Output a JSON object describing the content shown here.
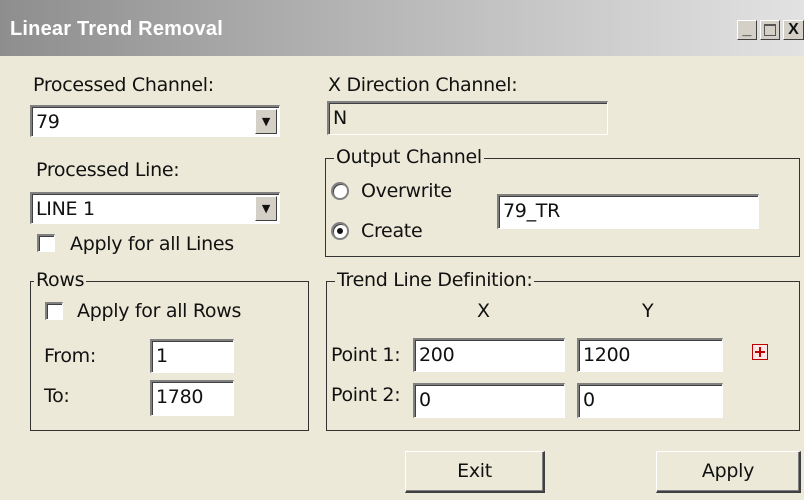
{
  "window": {
    "title": "Linear Trend Removal",
    "minimize_glyph": "_",
    "close_glyph": "X"
  },
  "processed_channel": {
    "label": "Processed Channel:",
    "value": "79"
  },
  "x_direction_channel": {
    "label": "X Direction Channel:",
    "value": "N"
  },
  "processed_line": {
    "label": "Processed Line:",
    "value": "LINE 1",
    "apply_all_label": "Apply for all Lines",
    "apply_all_checked": false
  },
  "output_channel": {
    "group_title": "Output Channel",
    "overwrite_label": "Overwrite",
    "create_label": "Create",
    "selected": "Create",
    "value": "79_TR"
  },
  "rows": {
    "group_title": "Rows",
    "apply_all_label": "Apply for all Rows",
    "apply_all_checked": false,
    "from_label": "From:",
    "from_value": "1",
    "to_label": "To:",
    "to_value": "1780"
  },
  "trend_line": {
    "group_title": "Trend Line Definition:",
    "x_header": "X",
    "y_header": "Y",
    "point1_label": "Point 1:",
    "point1_x": "200",
    "point1_y": "1200",
    "point2_label": "Point 2:",
    "point2_x": "0",
    "point2_y": "0",
    "pick_icon": "crosshair-pick-icon"
  },
  "buttons": {
    "exit_label": "Exit",
    "apply_label": "Apply"
  }
}
